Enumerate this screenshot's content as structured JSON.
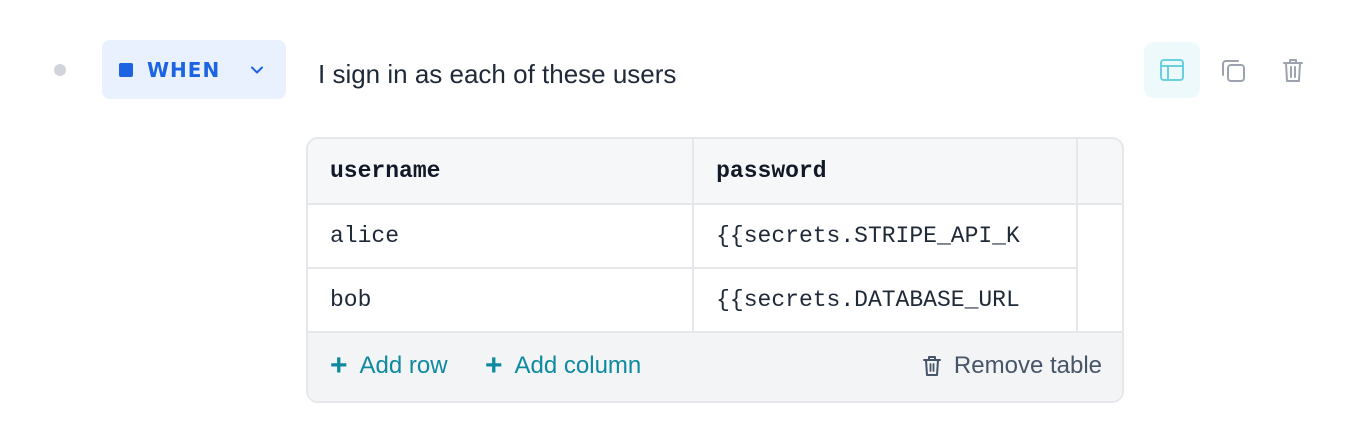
{
  "step": {
    "keyword": "WHEN",
    "text": "I sign in as each of these users"
  },
  "toolbar": {
    "icons": [
      "layout-icon",
      "copy-icon",
      "trash-icon"
    ]
  },
  "table": {
    "columns": [
      "username",
      "password"
    ],
    "rows": [
      [
        "alice",
        "{{secrets.STRIPE_API_K"
      ],
      [
        "bob",
        "{{secrets.DATABASE_URL"
      ]
    ]
  },
  "footer": {
    "add_row": "Add row",
    "add_column": "Add column",
    "remove_table": "Remove table"
  },
  "colors": {
    "keyword_blue": "#1d64e3",
    "keyword_bg": "#e8f1fd",
    "action_teal": "#0e8aa0"
  }
}
